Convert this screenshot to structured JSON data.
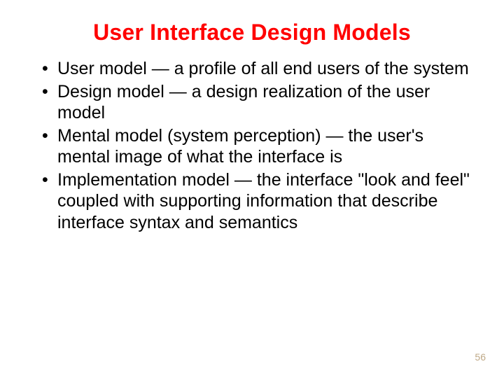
{
  "title": "User Interface Design Models",
  "bullets": [
    "User model — a profile of all end users of the system",
    "Design model — a design realization of the user model",
    "Mental model (system perception) — the user's mental image of what the interface is",
    "Implementation model — the interface \"look and feel\" coupled with supporting information that describe interface syntax and semantics"
  ],
  "page_number": "56"
}
